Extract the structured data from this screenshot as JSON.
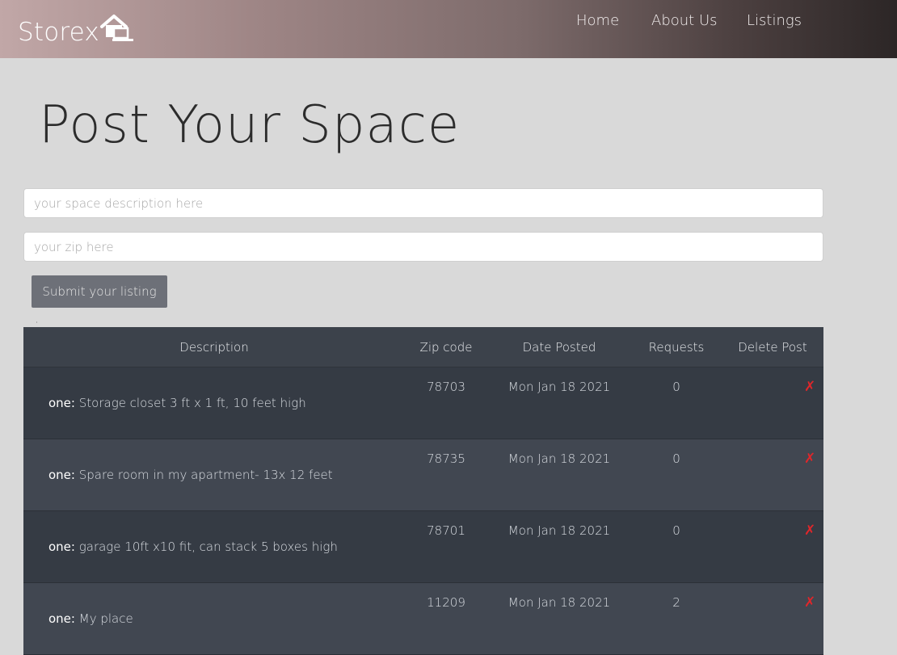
{
  "navbar": {
    "brand": "Storex",
    "brand_icon": "house-laptop-icon",
    "links": [
      "Home",
      "About Us",
      "Listings"
    ]
  },
  "page": {
    "title": "Post Your Space"
  },
  "form": {
    "description_placeholder": "your space description here",
    "description_value": "",
    "zip_placeholder": "your zip here",
    "zip_value": "",
    "submit_label": "Submit your listing",
    "stray_mark": ","
  },
  "table": {
    "headers": [
      "Description",
      "Zip code",
      "Date Posted",
      "Requests",
      "Delete Post"
    ],
    "delete_glyph": "✗",
    "rows": [
      {
        "prefix": "one:",
        "description": "Storage closet 3 ft x 1 ft, 10 feet high",
        "zip": "78703",
        "date": "Mon Jan 18 2021",
        "requests": "0"
      },
      {
        "prefix": "one:",
        "description": "Spare room in my apartment- 13x 12 feet",
        "zip": "78735",
        "date": "Mon Jan 18 2021",
        "requests": "0"
      },
      {
        "prefix": "one:",
        "description": "garage 10ft x10 fit, can stack 5 boxes high",
        "zip": "78701",
        "date": "Mon Jan 18 2021",
        "requests": "0"
      },
      {
        "prefix": "one:",
        "description": "My place",
        "zip": "11209",
        "date": "Mon Jan 18 2021",
        "requests": "2"
      }
    ]
  },
  "colors": {
    "delete": "#e0262a",
    "header_row": "#3c424b",
    "row_dark": "#353b44",
    "row_light": "#414751",
    "page_bg": "#d9d9d9"
  }
}
